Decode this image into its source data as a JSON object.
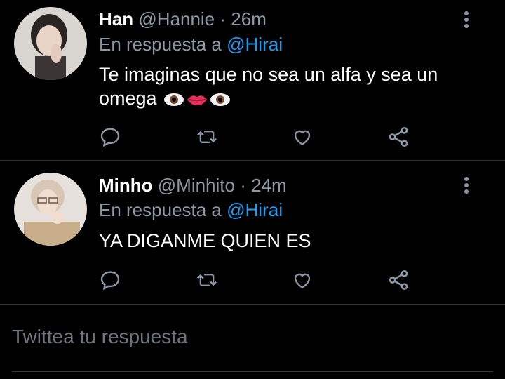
{
  "tweets": [
    {
      "name": "Han",
      "handle": "@Hannie",
      "time": "26m",
      "reply_prefix": "En respuesta a",
      "reply_to": "@Hirai",
      "text": "Te imaginas que no sea un alfa y sea un omega",
      "emojis": [
        "eye-icon",
        "lips-icon",
        "eye-icon"
      ]
    },
    {
      "name": "Minho",
      "handle": "@Minhito",
      "time": "24m",
      "reply_prefix": "En respuesta a",
      "reply_to": "@Hirai",
      "text": "YA DIGANME QUIEN ES"
    }
  ],
  "actions": [
    "reply-icon",
    "retweet-icon",
    "like-icon",
    "share-icon"
  ],
  "composer": {
    "placeholder": "Twittea tu respuesta"
  },
  "colors": {
    "background": "#000000",
    "secondary": "#8b98a5",
    "accent": "#1d9bf0",
    "icon": "#8b98a5"
  }
}
